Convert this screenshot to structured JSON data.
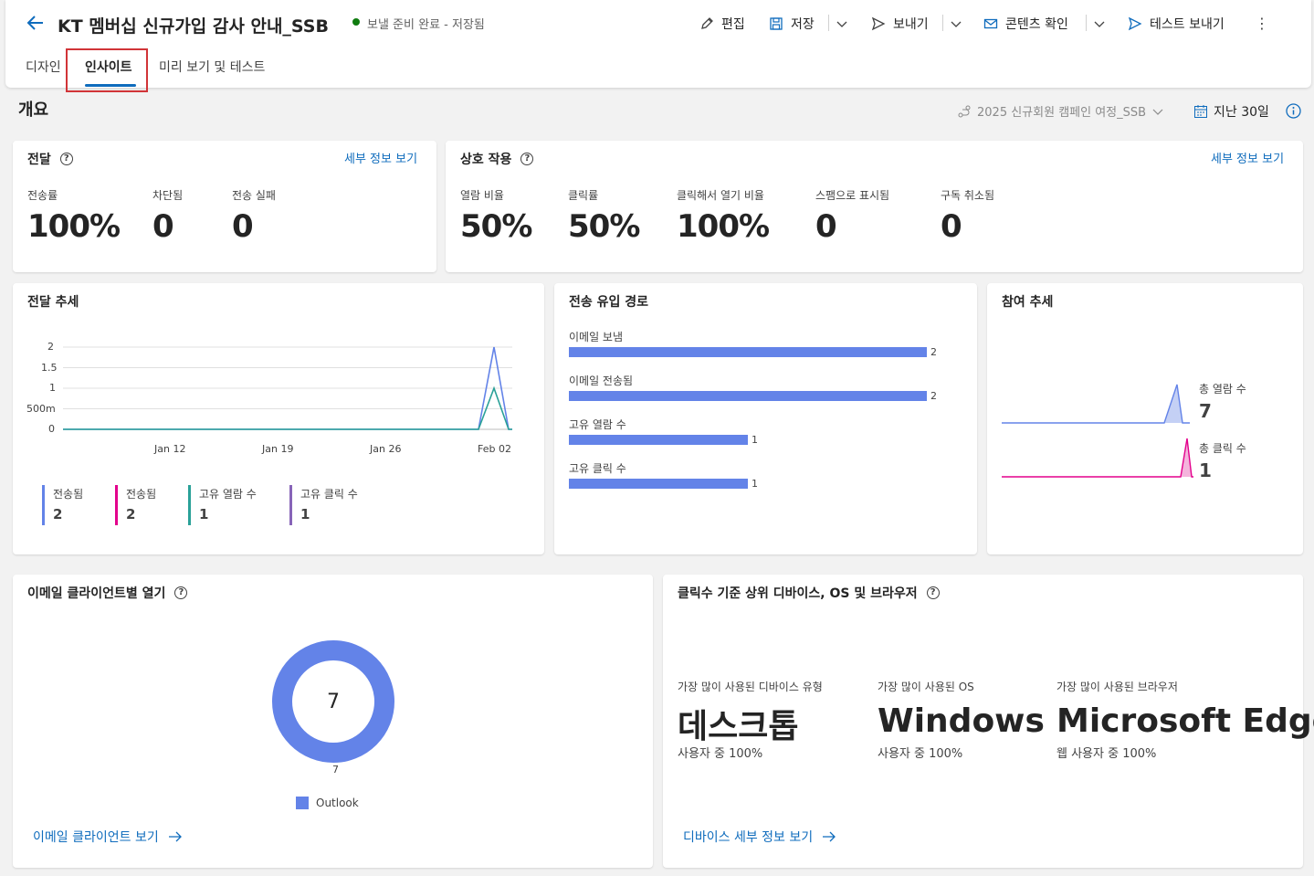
{
  "header": {
    "title": "KT 멤버십 신규가입 감사 안내_SSB",
    "status": "보낼 준비 완료 - 저장됨",
    "toolbar": {
      "edit": "편집",
      "save": "저장",
      "send": "보내기",
      "content_check": "콘텐츠 확인",
      "test_send": "테스트 보내기"
    },
    "tabs": [
      "디자인",
      "인사이트",
      "미리 보기 및 테스트"
    ],
    "active_tab": "인사이트"
  },
  "overview": {
    "title": "개요",
    "journey_filter": "2025 신규회원 캠페인 여정_SSB",
    "date_filter": "지난 30일"
  },
  "delivery": {
    "title": "전달",
    "details_link": "세부 정보 보기",
    "metrics": [
      {
        "label": "전송률",
        "value": "100%"
      },
      {
        "label": "차단됨",
        "value": "0"
      },
      {
        "label": "전송 실패",
        "value": "0"
      }
    ]
  },
  "interaction": {
    "title": "상호 작용",
    "details_link": "세부 정보 보기",
    "metrics": [
      {
        "label": "열람 비율",
        "value": "50%"
      },
      {
        "label": "클릭률",
        "value": "50%"
      },
      {
        "label": "클릭해서 열기 비율",
        "value": "100%"
      },
      {
        "label": "스팸으로 표시됨",
        "value": "0"
      },
      {
        "label": "구독 취소됨",
        "value": "0"
      }
    ]
  },
  "delivery_trend": {
    "title": "전달 추세",
    "y_ticks": [
      "2",
      "1.5",
      "1",
      "500m",
      "0"
    ],
    "x_ticks": [
      "Jan 12",
      "Jan 19",
      "Jan 26",
      "Feb 02"
    ],
    "legend": [
      {
        "label": "전송됨",
        "value": "2",
        "color": "#6383e8"
      },
      {
        "label": "전송됨",
        "value": "2",
        "color": "#e3008c"
      },
      {
        "label": "고유 열람 수",
        "value": "1",
        "color": "#2aa198"
      },
      {
        "label": "고유 클릭 수",
        "value": "1",
        "color": "#8764b8"
      }
    ]
  },
  "chart_data": [
    {
      "type": "line",
      "title": "전달 추세",
      "x": [
        "Jan 12",
        "Jan 19",
        "Jan 26",
        "Feb 02"
      ],
      "ylim": [
        0,
        2
      ],
      "series": [
        {
          "name": "전송됨",
          "peak": 2,
          "color": "#6383e8"
        },
        {
          "name": "고유 열람 수",
          "peak": 1,
          "color": "#2aa198"
        }
      ]
    },
    {
      "type": "bar",
      "title": "전송 유입 경로",
      "categories": [
        "이메일 보냄",
        "이메일 전송됨",
        "고유 열람 수",
        "고유 클릭 수"
      ],
      "values": [
        2,
        2,
        1,
        1
      ],
      "color": "#6383e8"
    },
    {
      "type": "pie",
      "title": "이메일 클라이언트별 열기",
      "categories": [
        "Outlook"
      ],
      "values": [
        7
      ],
      "color": "#6383e8"
    }
  ],
  "funnel": {
    "title": "전송 유입 경로"
  },
  "engagement": {
    "title": "참여 추세",
    "items": [
      {
        "label": "총 열람 수",
        "value": "7",
        "color": "#6383e8"
      },
      {
        "label": "총 클릭 수",
        "value": "1",
        "color": "#e3008c"
      }
    ]
  },
  "email_clients": {
    "title": "이메일 클라이언트별 열기",
    "total": "7",
    "slice_label": "7",
    "legend": "Outlook",
    "link": "이메일 클라이언트 보기"
  },
  "devices": {
    "title": "클릭수 기준 상위 디바이스, OS 및 브라우저",
    "items": [
      {
        "label": "가장 많이 사용된 디바이스 유형",
        "value": "데스크톱",
        "sub": "사용자 중 100%"
      },
      {
        "label": "가장 많이 사용된 OS",
        "value": "Windows",
        "sub": "사용자 중 100%"
      },
      {
        "label": "가장 많이 사용된 브라우저",
        "value": "Microsoft Edge",
        "sub": "웹 사용자 중 100%"
      }
    ],
    "link": "디바이스 세부 정보 보기"
  }
}
